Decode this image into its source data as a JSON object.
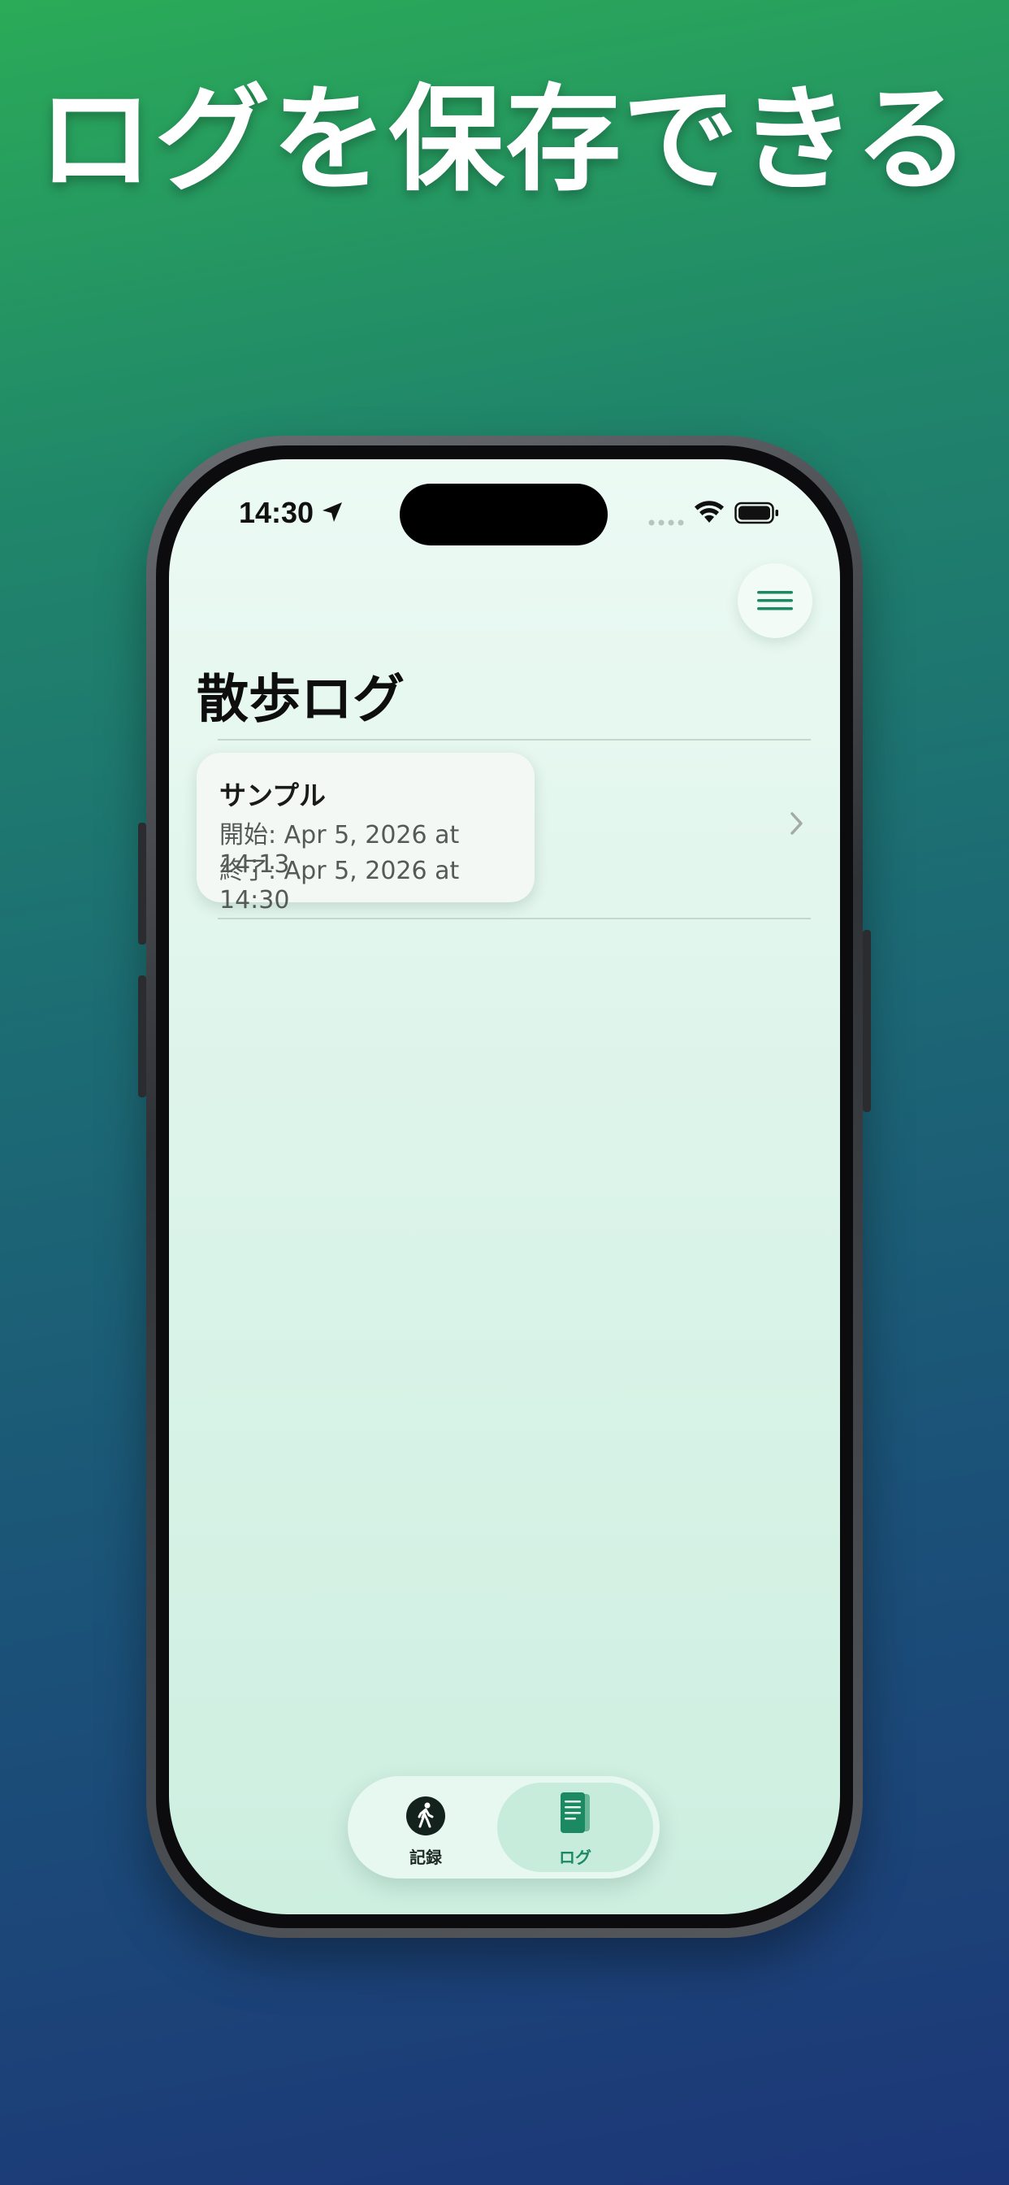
{
  "headline": "ログを保存できる",
  "status_bar": {
    "time": "14:30"
  },
  "page": {
    "title": "散歩ログ"
  },
  "logs": [
    {
      "name": "サンプル",
      "start": "開始: Apr 5, 2026 at 14:13",
      "end": "終了: Apr 5, 2026 at 14:30"
    }
  ],
  "tabs": [
    {
      "label": "記録",
      "icon": "walking-person-icon",
      "selected": false
    },
    {
      "label": "ログ",
      "icon": "document-list-icon",
      "selected": true
    }
  ],
  "colors": {
    "accent": "#1b8a62",
    "screen_background": "#ddf4ea",
    "tab_selected_background": "#c8ecdc"
  }
}
